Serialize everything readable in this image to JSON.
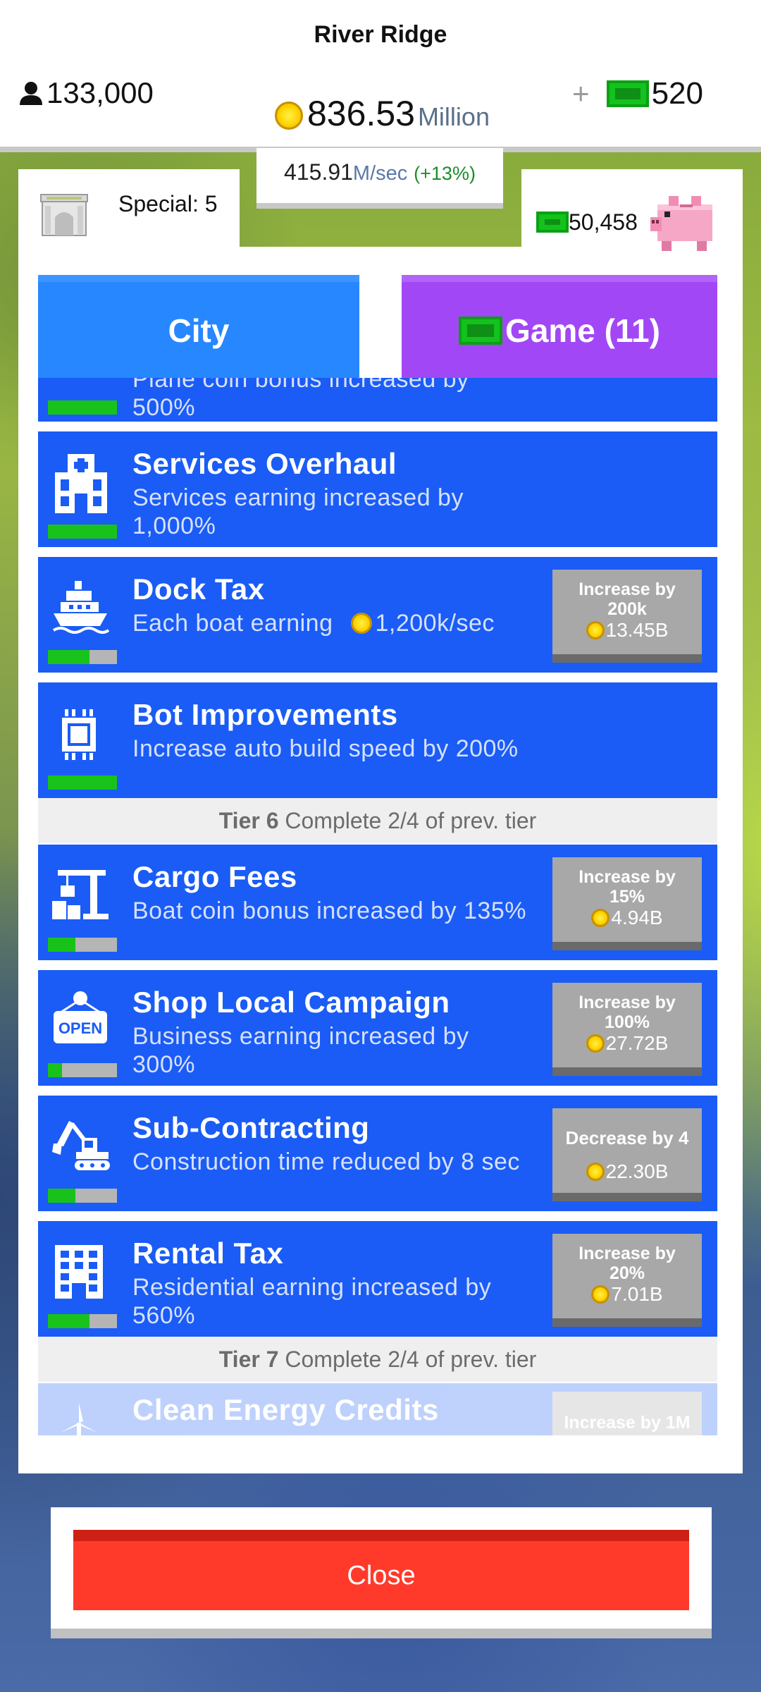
{
  "header": {
    "city_name": "River Ridge",
    "population": "133,000",
    "coins": "836.53",
    "coins_unit": "Million",
    "cash": "520",
    "plus": "+",
    "rate_value": "415.91",
    "rate_unit": "M/sec",
    "rate_bonus": "(+13%)"
  },
  "panel": {
    "special_label": "Special: 5",
    "cash_balance": "50,458",
    "tabs": {
      "city": "City",
      "game": "Game (11)"
    }
  },
  "upgrades": [
    {
      "title": "",
      "desc": "Plane coin bonus increased by",
      "desc2": "500%",
      "progress": 1.0,
      "icon": "plane-icon"
    },
    {
      "title": "Services Overhaul",
      "desc": "Services earning increased by",
      "desc2": "1,000%",
      "progress": 1.0,
      "icon": "hospital-icon"
    },
    {
      "title": "Dock Tax",
      "desc": "Each boat earning",
      "desc_value": "1,200k/sec",
      "progress": 0.6,
      "icon": "boat-icon",
      "buy": {
        "line1": "Increase by",
        "line2": "200k",
        "cost": "13.45B"
      }
    },
    {
      "title": "Bot Improvements",
      "desc": "Increase auto build speed by 200%",
      "progress": 1.0,
      "icon": "chip-icon"
    },
    {
      "title": "Cargo Fees",
      "desc": "Boat coin bonus increased by 135%",
      "progress": 0.4,
      "icon": "crane-icon",
      "buy": {
        "line1": "Increase by",
        "line2": "15%",
        "cost": "4.94B"
      }
    },
    {
      "title": "Shop Local Campaign",
      "desc": "Business earning increased by",
      "desc2": "300%",
      "progress": 0.2,
      "icon": "open-sign-icon",
      "buy": {
        "line1": "Increase by",
        "line2": "100%",
        "cost": "27.72B"
      }
    },
    {
      "title": "Sub-Contracting",
      "desc": "Construction time reduced by 8 sec",
      "progress": 0.4,
      "icon": "excavator-icon",
      "buy": {
        "line1": "Decrease by 4",
        "line2": "",
        "cost": "22.30B"
      }
    },
    {
      "title": "Rental Tax",
      "desc": "Residential earning increased by",
      "desc2": "560%",
      "progress": 0.6,
      "icon": "apartment-icon",
      "buy": {
        "line1": "Increase by",
        "line2": "20%",
        "cost": "7.01B"
      }
    },
    {
      "title": "Clean Energy Credits",
      "progress": 0,
      "icon": "wind-turbine-icon",
      "buy": {
        "line1": "Increase by 1M"
      }
    }
  ],
  "tiers": [
    {
      "label": "Tier 6",
      "text": "Complete 2/4 of prev. tier"
    },
    {
      "label": "Tier 7",
      "text": "Complete 2/4 of prev. tier"
    }
  ],
  "close_label": "Close",
  "colors": {
    "row_blue": "#1a5cf5",
    "tab_city": "#2787ff",
    "tab_game": "#a247f5",
    "progress_green": "#19c21b",
    "close_red": "#ff3a2b"
  }
}
